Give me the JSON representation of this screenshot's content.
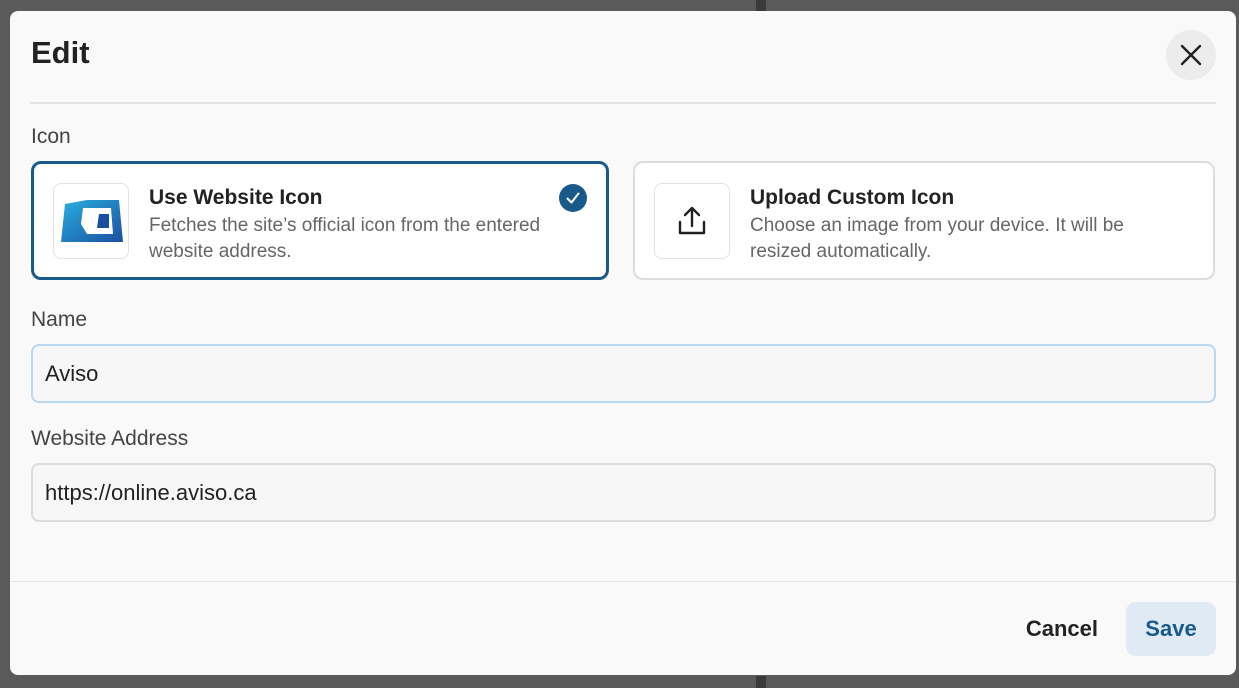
{
  "dialog": {
    "title": "Edit",
    "close_icon": "close-icon"
  },
  "icon_section": {
    "label": "Icon",
    "options": [
      {
        "title": "Use Website Icon",
        "description": "Fetches the site’s official icon from the entered website address.",
        "icon": "aviso-logo-icon",
        "selected": true
      },
      {
        "title": "Upload Custom Icon",
        "description": "Choose an image from your device. It will be resized automatically.",
        "icon": "upload-icon",
        "selected": false
      }
    ]
  },
  "name_field": {
    "label": "Name",
    "value": "Aviso"
  },
  "address_field": {
    "label": "Website Address",
    "value": "https://online.aviso.ca"
  },
  "footer": {
    "cancel_label": "Cancel",
    "save_label": "Save"
  },
  "colors": {
    "accent": "#1a5a8a",
    "save_bg": "#dfeaf5",
    "focus_border": "#b9d9f2"
  }
}
